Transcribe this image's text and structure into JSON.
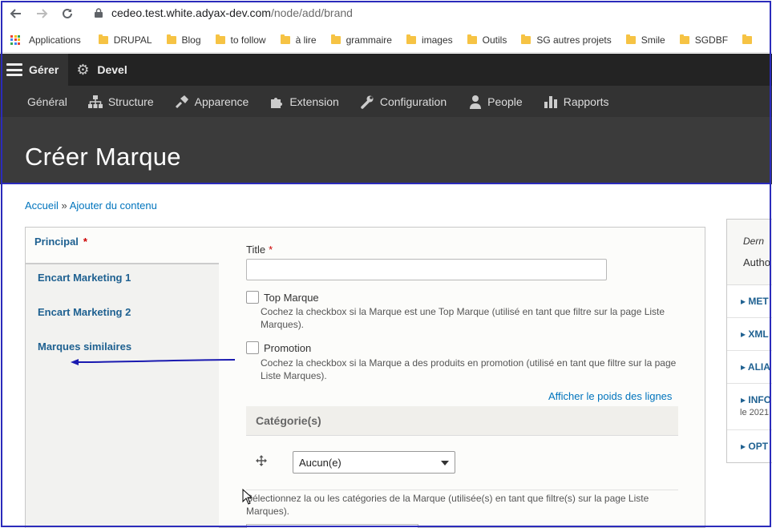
{
  "browser": {
    "url_host": "cedeo.test.white.adyax-dev.com",
    "url_path": "/node/add/brand",
    "bookmarks": [
      "Applications",
      "DRUPAL",
      "Blog",
      "to follow",
      "à lire",
      "grammaire",
      "images",
      "Outils",
      "SG autres projets",
      "Smile",
      "SGDBF"
    ]
  },
  "toolbar": {
    "manage": "Gérer",
    "devel": "Devel",
    "tray": [
      "Général",
      "Structure",
      "Apparence",
      "Extension",
      "Configuration",
      "People",
      "Rapports"
    ]
  },
  "page": {
    "title": "Créer Marque",
    "breadcrumb_home": "Accueil",
    "breadcrumb_sep": "»",
    "breadcrumb_add": "Ajouter du contenu"
  },
  "tabs": [
    "Principal",
    "Encart Marketing 1",
    "Encart Marketing 2",
    "Marques similaires"
  ],
  "required_mark": "*",
  "form": {
    "title_label": "Title",
    "title_value": "",
    "top_marque_label": "Top Marque",
    "top_marque_desc": "Cochez la checkbox si la Marque est une Top Marque (utilisé en tant que filtre sur la page Liste Marques).",
    "promotion_label": "Promotion",
    "promotion_desc": "Cochez la checkbox si la Marque a des produits en promotion (utilisé en tant que filtre sur la page Liste Marques).",
    "show_weights": "Afficher le poids des lignes",
    "categories_title": "Catégorie(s)",
    "category_select": "Aucun(e)",
    "categories_desc": "Sélectionnez la ou les catégories de la Marque (utilisée(s) en tant que filtre(s) sur la page Liste Marques)."
  },
  "sidebar": {
    "last_saved": "Dern",
    "author": "Autho",
    "items": [
      "MET",
      "XML",
      "ALIA",
      "INFO",
      "OPT"
    ],
    "info_sub": "le 2021"
  },
  "colors": {
    "toolbar": "#232323",
    "tray": "#333333",
    "header": "#3b3b3b",
    "link": "#0074bd",
    "annotation": "#2b2bbb"
  }
}
